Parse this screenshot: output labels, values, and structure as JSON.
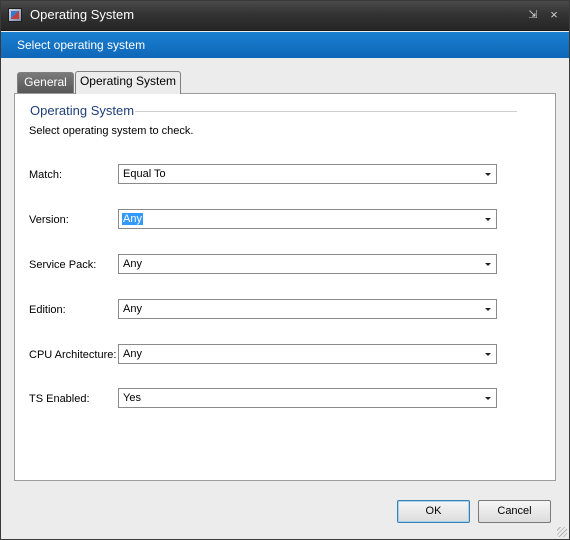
{
  "window": {
    "title": "Operating System",
    "icon": "app-window-icon",
    "title_buttons": {
      "pin": "⇲",
      "close": "×"
    }
  },
  "header": {
    "text": "Select operating system"
  },
  "tabs": [
    {
      "label": "General",
      "active": false
    },
    {
      "label": "Operating System",
      "active": true
    }
  ],
  "group": {
    "title": "Operating System",
    "description": "Select operating system to check."
  },
  "fields": [
    {
      "label": "Match:",
      "value": "Equal To"
    },
    {
      "label": "Version:",
      "value": "Any",
      "selected": true
    },
    {
      "label": "Service Pack:",
      "value": "Any"
    },
    {
      "label": "Edition:",
      "value": "Any"
    },
    {
      "label": "CPU Architecture:",
      "value": "Any"
    },
    {
      "label": "TS Enabled:",
      "value": "Yes"
    }
  ],
  "buttons": {
    "ok": "OK",
    "cancel": "Cancel"
  },
  "colors": {
    "header_band": "#0f67b8",
    "titlebar": "#2f2f2f",
    "group_title": "#1f3f7a"
  }
}
